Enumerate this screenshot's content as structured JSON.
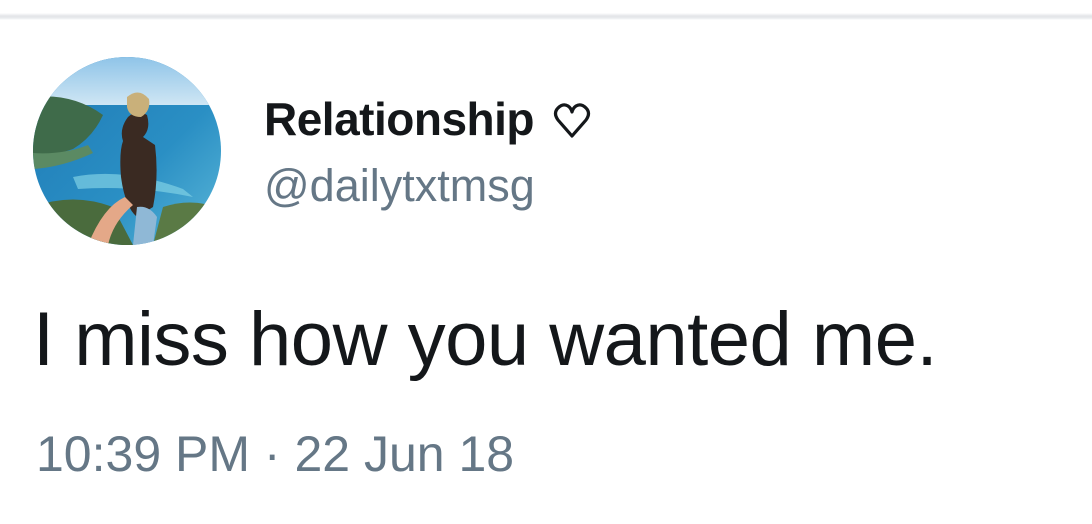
{
  "tweet": {
    "author": {
      "display_name": "Relationship",
      "handle": "@dailytxtmsg",
      "name_badge_icon": "heart-outline-icon",
      "avatar_image": "avatar-photo"
    },
    "text": "I miss how you wanted me.",
    "time": "10:39 PM",
    "separator": "·",
    "date": "22 Jun 18"
  },
  "colors": {
    "primary_text": "#14171a",
    "secondary_text": "#657786",
    "divider": "#e6e8eb",
    "background": "#ffffff"
  }
}
